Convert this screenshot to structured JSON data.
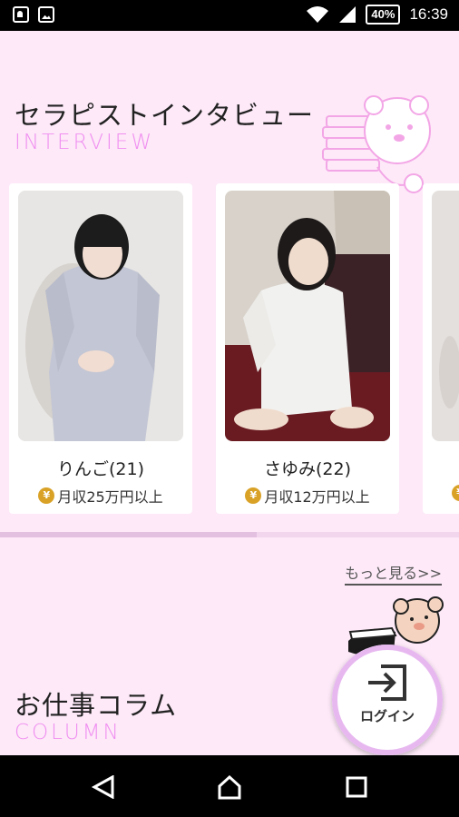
{
  "status_bar": {
    "battery": "40%",
    "time": "16:39"
  },
  "interview": {
    "title": "セラピストインタビュー",
    "subtitle": "INTERVIEW",
    "cards": [
      {
        "name": "りんご(21)",
        "income": "月収25万円以上"
      },
      {
        "name": "さゆみ(22)",
        "income": "月収12万円以上"
      }
    ],
    "more_link": "もっと見る>>",
    "scroll_progress": 0.56
  },
  "column": {
    "title": "お仕事コラム",
    "subtitle": "COLUMN"
  },
  "login_button": {
    "label": "ログイン"
  },
  "colors": {
    "background": "#fde9f8",
    "accent_pink": "#f08ff0",
    "login_ring": "#e7b8f0"
  },
  "icons": [
    "contact-icon",
    "image-icon",
    "wifi-icon",
    "signal-icon",
    "battery-icon",
    "coin-icon",
    "login-icon",
    "back-icon",
    "home-icon",
    "recents-icon",
    "bear-mascot-icon"
  ]
}
